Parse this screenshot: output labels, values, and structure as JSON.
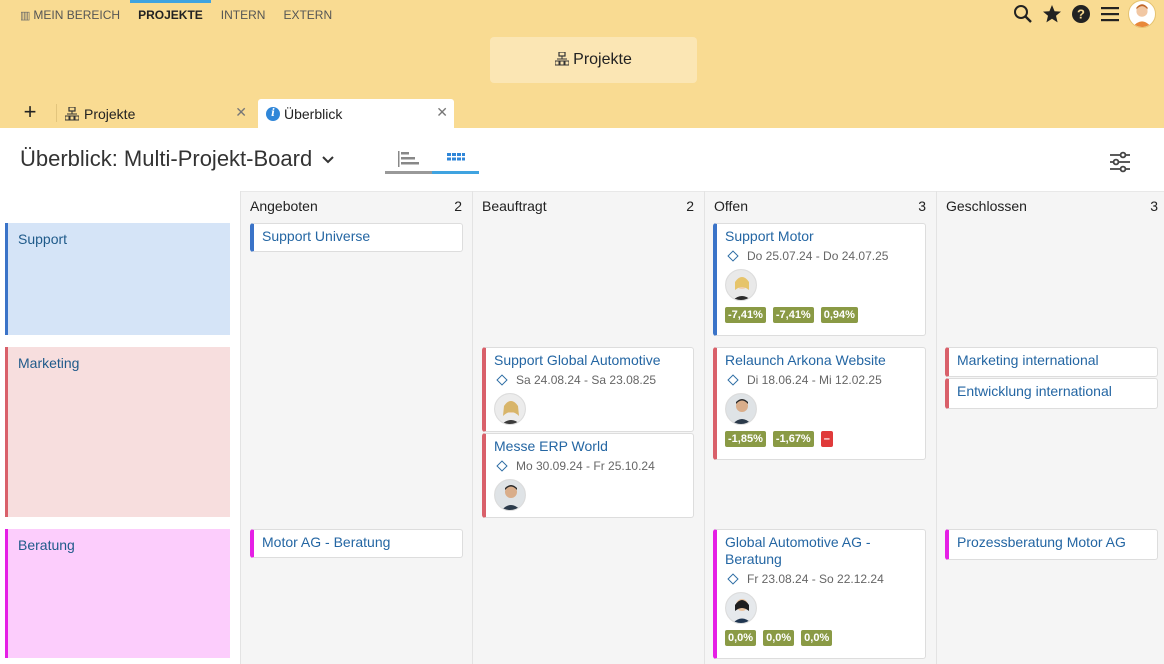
{
  "nav": {
    "items": [
      {
        "label": "MEIN BEREICH",
        "active": false
      },
      {
        "label": "PROJEKTE",
        "active": true
      },
      {
        "label": "INTERN",
        "active": false
      },
      {
        "label": "EXTERN",
        "active": false
      }
    ],
    "icons": [
      "search-icon",
      "star-icon",
      "help-icon",
      "menu-icon",
      "user-avatar"
    ]
  },
  "header": {
    "button_label": "Projekte"
  },
  "tabs": {
    "add_label": "+",
    "items": [
      {
        "label": "Projekte",
        "icon": "sitemap-icon"
      },
      {
        "label": "Überblick",
        "icon": "info-icon"
      }
    ]
  },
  "page": {
    "title": "Überblick: Multi-Projekt-Board"
  },
  "board": {
    "columns": [
      {
        "name": "Angeboten",
        "count": "2"
      },
      {
        "name": "Beauftragt",
        "count": "2"
      },
      {
        "name": "Offen",
        "count": "3"
      },
      {
        "name": "Geschlossen",
        "count": "3"
      }
    ],
    "lanes": [
      {
        "name": "Support",
        "color": "#3a73c8",
        "bg": "#d5e4f7"
      },
      {
        "name": "Marketing",
        "color": "#d9606a",
        "bg": "#f7dede"
      },
      {
        "name": "Beratung",
        "color": "#e51fe5",
        "bg": "#fccdfc"
      }
    ],
    "cards": {
      "support_universe": {
        "title": "Support Universe"
      },
      "support_motor": {
        "title": "Support Motor",
        "date": "Do 25.07.24 - Do 24.07.25",
        "kpis": [
          "-7,41%",
          "-7,41%",
          "0,94%"
        ]
      },
      "support_global": {
        "title": "Support Global Automotive",
        "date": "Sa 24.08.24 - Sa 23.08.25"
      },
      "messe_erp": {
        "title": "Messe ERP World",
        "date": "Mo 30.09.24 - Fr 25.10.24"
      },
      "relaunch": {
        "title": "Relaunch Arkona Website",
        "date": "Di 18.06.24 - Mi 12.02.25",
        "kpis": [
          "-1,85%",
          "-1,67%",
          "–"
        ]
      },
      "marketing_int": {
        "title": "Marketing international"
      },
      "entwicklung_int": {
        "title": "Entwicklung international"
      },
      "motor_beratung": {
        "title": "Motor AG - Beratung"
      },
      "global_beratung": {
        "title": "Global Automotive AG - Beratung",
        "date": "Fr 23.08.24 - So 22.12.24",
        "kpis": [
          "0,0%",
          "0,0%",
          "0,0%"
        ]
      },
      "prozess": {
        "title": "Prozessberatung Motor AG"
      }
    }
  },
  "colors": {
    "topbar": "#f9db92",
    "accent": "#3fa3e0",
    "kpi_green": "#8a9a45",
    "kpi_red": "#e03a3a"
  }
}
